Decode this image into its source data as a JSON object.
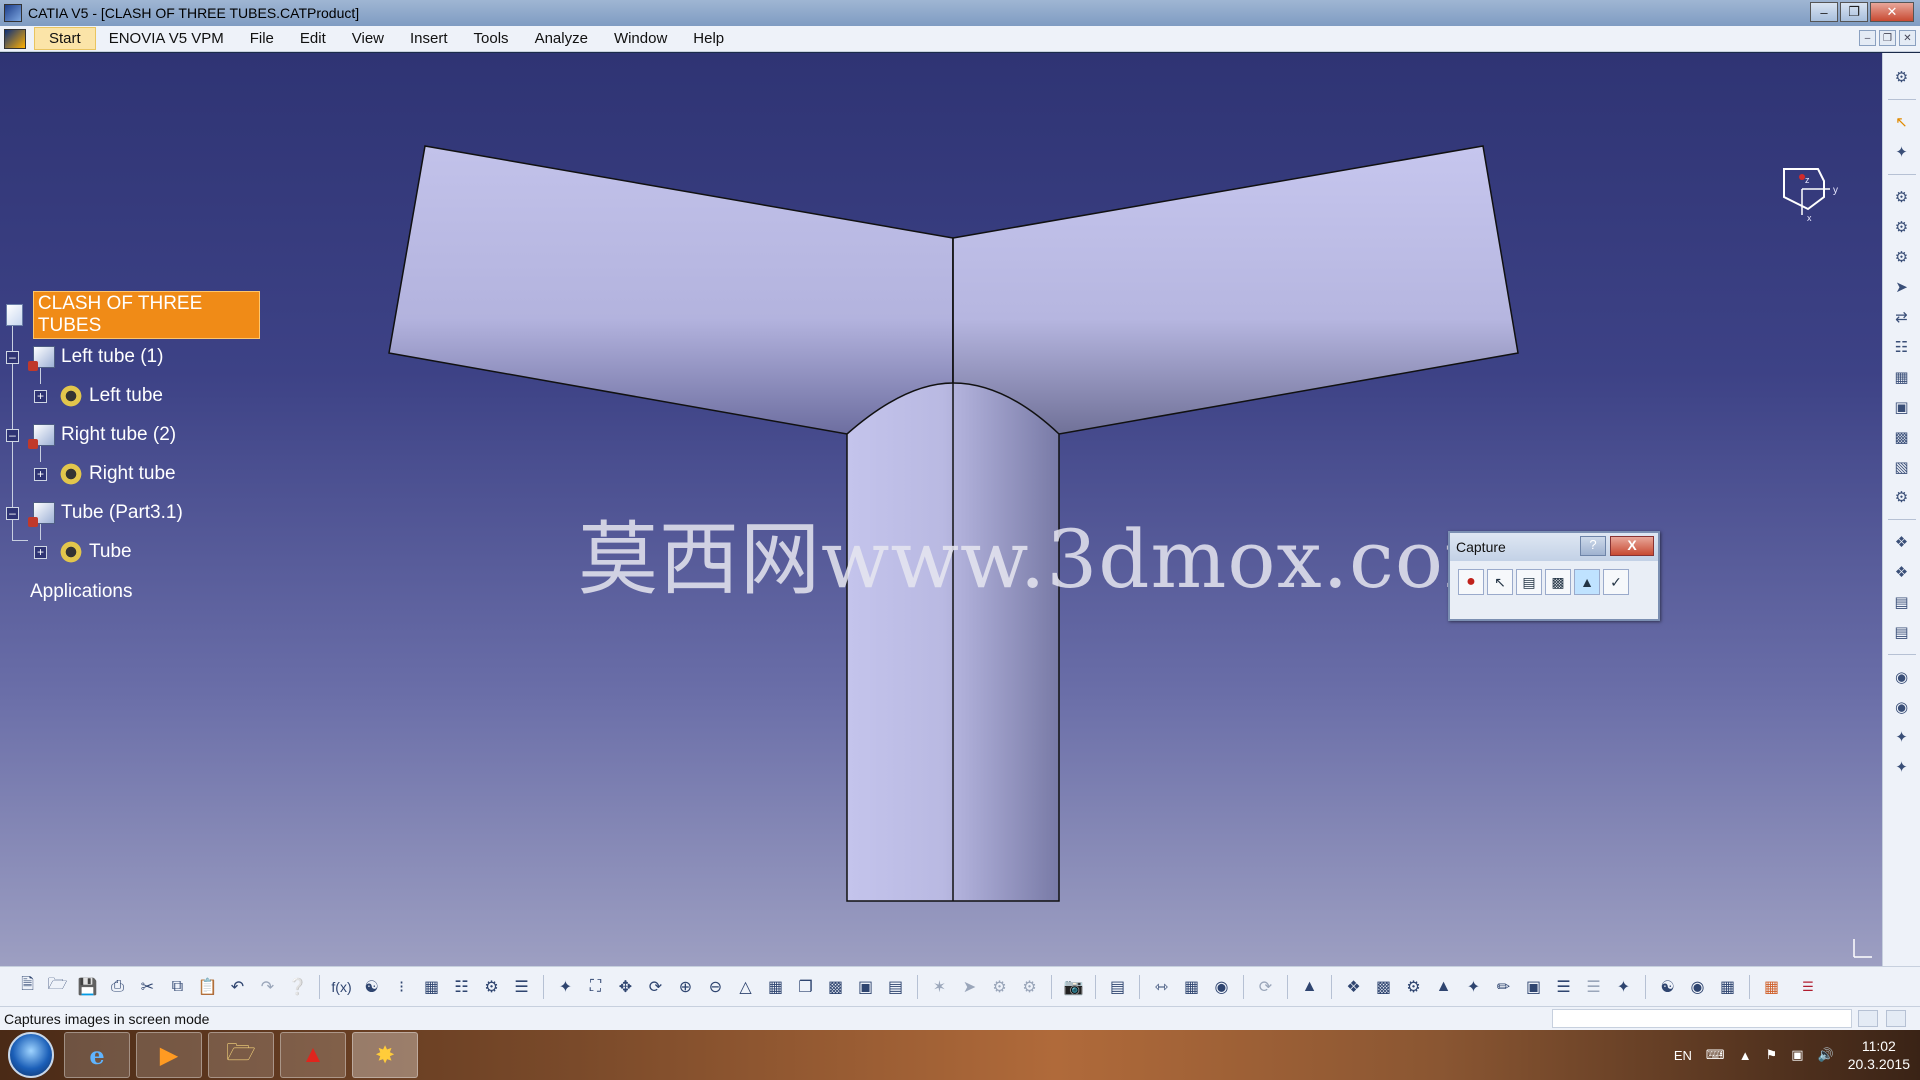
{
  "window": {
    "title": "CATIA V5 - [CLASH OF THREE TUBES.CATProduct]"
  },
  "menu": {
    "items": [
      "Start",
      "ENOVIA V5 VPM",
      "File",
      "Edit",
      "View",
      "Insert",
      "Tools",
      "Analyze",
      "Window",
      "Help"
    ]
  },
  "tree": {
    "root": "CLASH OF THREE TUBES",
    "nodes": [
      {
        "label": "Left tube (1)"
      },
      {
        "label": "Left tube"
      },
      {
        "label": "Right tube (2)"
      },
      {
        "label": "Right tube"
      },
      {
        "label": "Tube (Part3.1)"
      },
      {
        "label": "Tube"
      },
      {
        "label": "Applications"
      }
    ]
  },
  "watermark": "莫西网www.3dmox.com",
  "compass": {
    "axis_z": "z",
    "axis_y": "y",
    "axis_x": "x"
  },
  "capture_toolbar": {
    "title": "Capture",
    "help": "?",
    "close": "X",
    "tools": [
      "record-icon",
      "select-icon",
      "options-icon",
      "capture-icon",
      "image-icon",
      "album-icon"
    ]
  },
  "status": {
    "message": "Captures images in screen mode"
  },
  "taskbar": {
    "language": "EN",
    "time": "11:02",
    "date": "20.3.2015",
    "apps": [
      "ie-icon",
      "media-player-icon",
      "file-explorer-icon",
      "acrobat-icon",
      "catia-icon"
    ]
  },
  "colors": {
    "viewport_top": "#2f3474",
    "viewport_bottom": "#9d9fc2",
    "tube_fill": "#b9b9e4",
    "tree_root_highlight": "#f08b17"
  }
}
